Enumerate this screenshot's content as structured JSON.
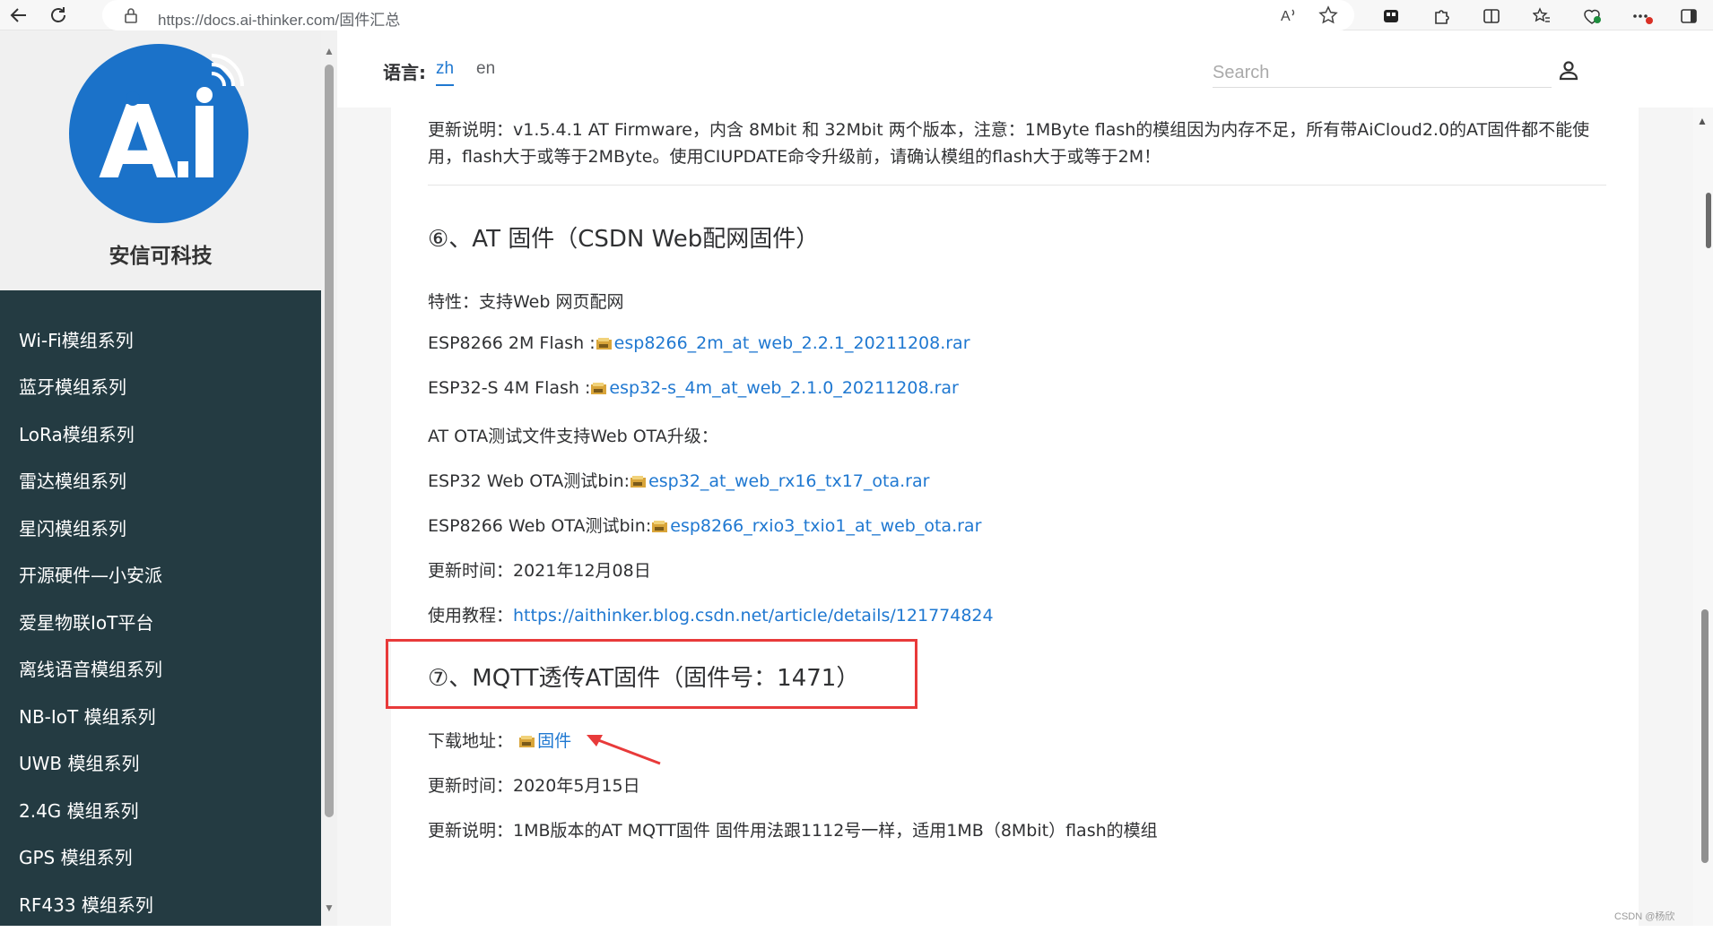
{
  "browser": {
    "url": "https://docs.ai-thinker.com/固件汇总"
  },
  "sidebar": {
    "brand_name": "安信可科技",
    "logo_text": "A.i",
    "items": [
      {
        "label": "Wi-Fi模组系列"
      },
      {
        "label": "蓝牙模组系列"
      },
      {
        "label": "LoRa模组系列"
      },
      {
        "label": "雷达模组系列"
      },
      {
        "label": "星闪模组系列"
      },
      {
        "label": "开源硬件—小安派"
      },
      {
        "label": "爱星物联IoT平台"
      },
      {
        "label": "离线语音模组系列"
      },
      {
        "label": "NB-IoT 模组系列"
      },
      {
        "label": "UWB 模组系列"
      },
      {
        "label": "2.4G 模组系列"
      },
      {
        "label": "GPS 模组系列"
      },
      {
        "label": "RF433 模组系列"
      }
    ]
  },
  "topbar": {
    "lang_label": "语言:",
    "lang_zh": "zh",
    "lang_en": "en",
    "search_placeholder": "Search"
  },
  "article": {
    "update_note_prev_line1": "更新说明：v1.5.4.1 AT Firmware，内含 8Mbit 和 32Mbit 两个版本，注意：1MByte flash的模组因为内存不足，所有带AiCloud2.0的AT固件都不能使",
    "update_note_prev_line2": "用，flash大于或等于2MByte。使用CIUPDATE命令升级前，请确认模组的flash大于或等于2M！",
    "section6": {
      "title": "⑥、AT 固件（CSDN Web配网固件）",
      "feature": "特性：支持Web 网页配网",
      "esp8266_label": "ESP8266 2M Flash :",
      "esp8266_link": "esp8266_2m_at_web_2.2.1_20211208.rar",
      "esp32s_label": "ESP32-S 4M Flash :",
      "esp32s_link": "esp32-s_4m_at_web_2.1.0_20211208.rar",
      "ota_note": "AT OTA测试文件支持Web OTA升级：",
      "esp32_ota_label": "ESP32 Web OTA测试bin:",
      "esp32_ota_link": "esp32_at_web_rx16_tx17_ota.rar",
      "esp8266_ota_label": "ESP8266 Web OTA测试bin:",
      "esp8266_ota_link": "esp8266_rxio3_txio1_at_web_ota.rar",
      "update_time": "更新时间：2021年12月08日",
      "tutorial_label": "使用教程：",
      "tutorial_link": "https://aithinker.blog.csdn.net/article/details/121774824"
    },
    "section7": {
      "title": "⑦、MQTT透传AT固件（固件号：1471）",
      "download_label": "下载地址：",
      "download_link": "固件",
      "update_time": "更新时间：2020年5月15日",
      "update_note": "更新说明：1MB版本的AT MQTT固件 固件用法跟1112号一样，适用1MB（8Mbit）flash的模组"
    }
  },
  "watermark": "CSDN @杨欣",
  "colors": {
    "sidebar_bg": "#243b42",
    "link": "#1f78d1",
    "highlight_box": "#e83a3a",
    "logo_blue": "#1b72c9"
  }
}
